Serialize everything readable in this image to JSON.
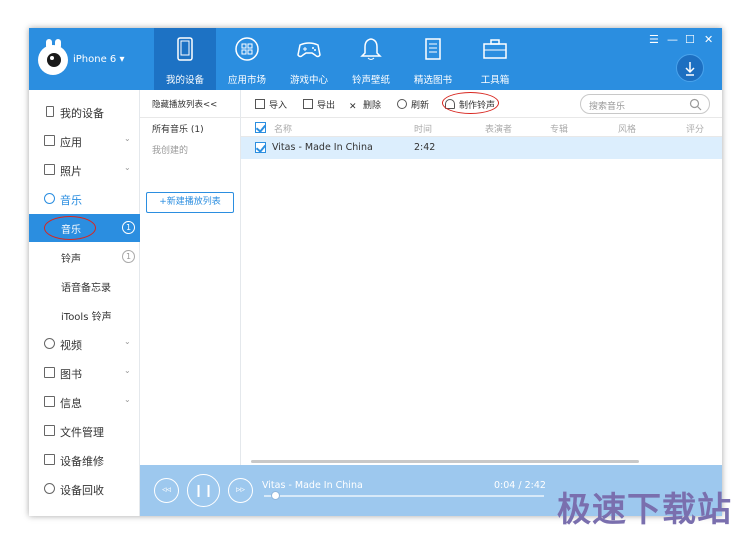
{
  "header": {
    "device_name": "iPhone 6 ▾",
    "tabs": [
      {
        "label": "我的设备",
        "icon": "tablet-icon"
      },
      {
        "label": "应用市场",
        "icon": "apps-grid-icon"
      },
      {
        "label": "游戏中心",
        "icon": "gamepad-icon"
      },
      {
        "label": "铃声壁纸",
        "icon": "bell-icon"
      },
      {
        "label": "精选图书",
        "icon": "book-icon"
      },
      {
        "label": "工具箱",
        "icon": "toolbox-icon"
      }
    ],
    "window_controls": [
      "☰",
      "—",
      "☐",
      "✕"
    ]
  },
  "sidebar": {
    "items": [
      {
        "label": "我的设备",
        "icon": "phone-icon"
      },
      {
        "label": "应用",
        "icon": "apps-icon",
        "chevron": "⌄"
      },
      {
        "label": "照片",
        "icon": "photo-icon",
        "chevron": "⌄"
      },
      {
        "label": "音乐",
        "icon": "music-icon"
      },
      {
        "label": "音乐",
        "badge": "1"
      },
      {
        "label": "铃声",
        "badge": "1"
      },
      {
        "label": "语音备忘录"
      },
      {
        "label": "iTools 铃声"
      },
      {
        "label": "视频",
        "icon": "video-icon",
        "chevron": "⌄"
      },
      {
        "label": "图书",
        "icon": "book-icon",
        "chevron": "⌄"
      },
      {
        "label": "信息",
        "icon": "message-icon",
        "chevron": "⌄"
      },
      {
        "label": "文件管理",
        "icon": "folder-icon"
      },
      {
        "label": "设备维修",
        "icon": "repair-icon"
      },
      {
        "label": "设备回收",
        "icon": "recycle-icon"
      }
    ]
  },
  "playlist": {
    "toggle": "隐藏播放列表<<",
    "all_music": "所有音乐 (1)",
    "my_created": "我创建的",
    "new_button": "+新建播放列表"
  },
  "toolbar": {
    "import": "导入",
    "export": "导出",
    "delete": "删除",
    "refresh": "刷新",
    "make_ringtone": "制作铃声",
    "search_placeholder": "搜索音乐"
  },
  "table": {
    "columns": [
      "名称",
      "时间",
      "表演者",
      "专辑",
      "风格",
      "评分"
    ],
    "rows": [
      {
        "name": "Vitas - Made In China",
        "time": "2:42"
      }
    ]
  },
  "player": {
    "track": "Vitas - Made In China",
    "time": "0:04 / 2:42",
    "progress": 0.025
  },
  "watermark": "极速下载站",
  "colors": {
    "accent": "#2b8ee0",
    "annotation": "#d8261f"
  }
}
